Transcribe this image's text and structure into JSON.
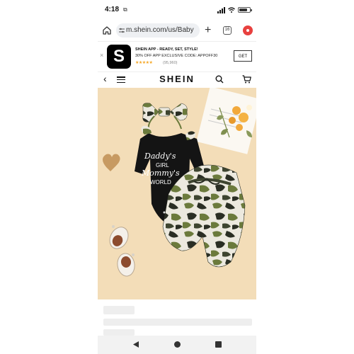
{
  "status_bar": {
    "time": "4:18",
    "media_icon": "media-icon"
  },
  "browser": {
    "url": "m.shein.com/us/Baby",
    "tab_count": "16"
  },
  "app_banner": {
    "close": "×",
    "logo_letter": "S",
    "title": "SHEIN APP - READY, SET, STYLE!",
    "promo": "30% OFF APP EXCLUSIVE CODE: APPOFF30",
    "stars": "★★★★★",
    "review_count": "(95,960)",
    "get_label": "GET"
  },
  "nav": {
    "back": "‹",
    "brand": "SHEIN"
  },
  "product": {
    "print_lines": [
      "Daddy's",
      "GIRL",
      "Mommy's",
      "WORLD"
    ],
    "colors": {
      "background": "#f3ddb8",
      "onesie": "#111111",
      "camo_base": "#ece9df",
      "camo_green": "#6b7a3c",
      "camo_dark": "#2a2e24"
    }
  }
}
